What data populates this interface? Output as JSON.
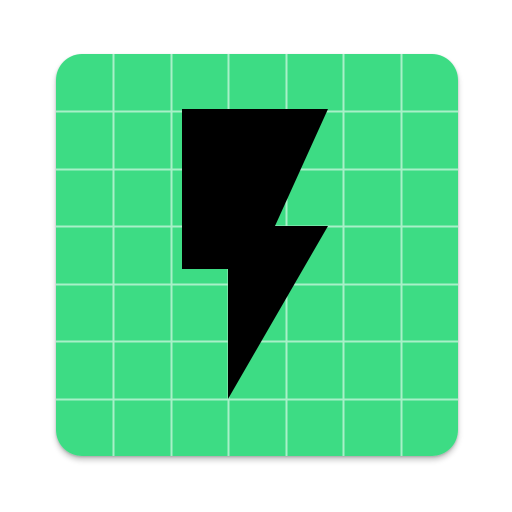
{
  "icon": {
    "name": "lightning-bolt-grid-app-icon",
    "symbol": "bolt-icon",
    "background_color": "#3ddc84",
    "grid_color": "#a8f0c8",
    "symbol_color": "#000000",
    "grid_columns": 7,
    "grid_rows": 7
  }
}
